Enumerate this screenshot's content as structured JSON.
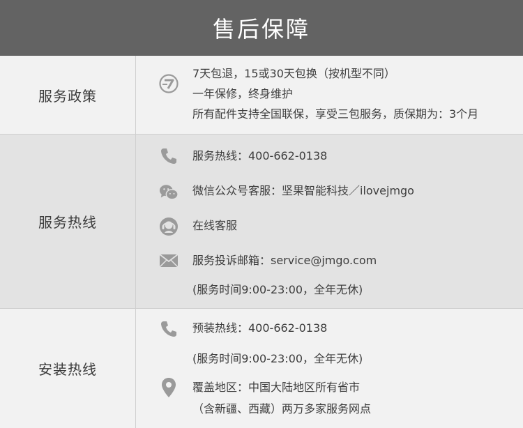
{
  "header": {
    "title": "售后保障"
  },
  "sections": [
    {
      "label": "服务政策",
      "lines": [
        "7天包退，15或30天包换（按机型不同）",
        "一年保修，终身维护",
        "所有配件支持全国联保，享受三包服务，质保期为：3个月"
      ]
    },
    {
      "label": "服务热线",
      "hotline": "服务热线：400-662-0138",
      "wechat": "微信公众号客服：坚果智能科技／ilovejmgo",
      "online": "在线客服",
      "email": "服务投诉邮箱：service@jmgo.com",
      "hours": "(服务时间9:00-23:00，全年无休)"
    },
    {
      "label": "安装热线",
      "hotline": "预装热线：400-662-0138",
      "hours": "(服务时间9:00-23:00，全年无休)",
      "coverage": "覆盖地区：中国大陆地区所有省市",
      "coverage_note": "（含新疆、西藏）两万多家服务网点"
    }
  ],
  "colors": {
    "header_bg": "#636363",
    "icon": "#9a9a9a"
  }
}
